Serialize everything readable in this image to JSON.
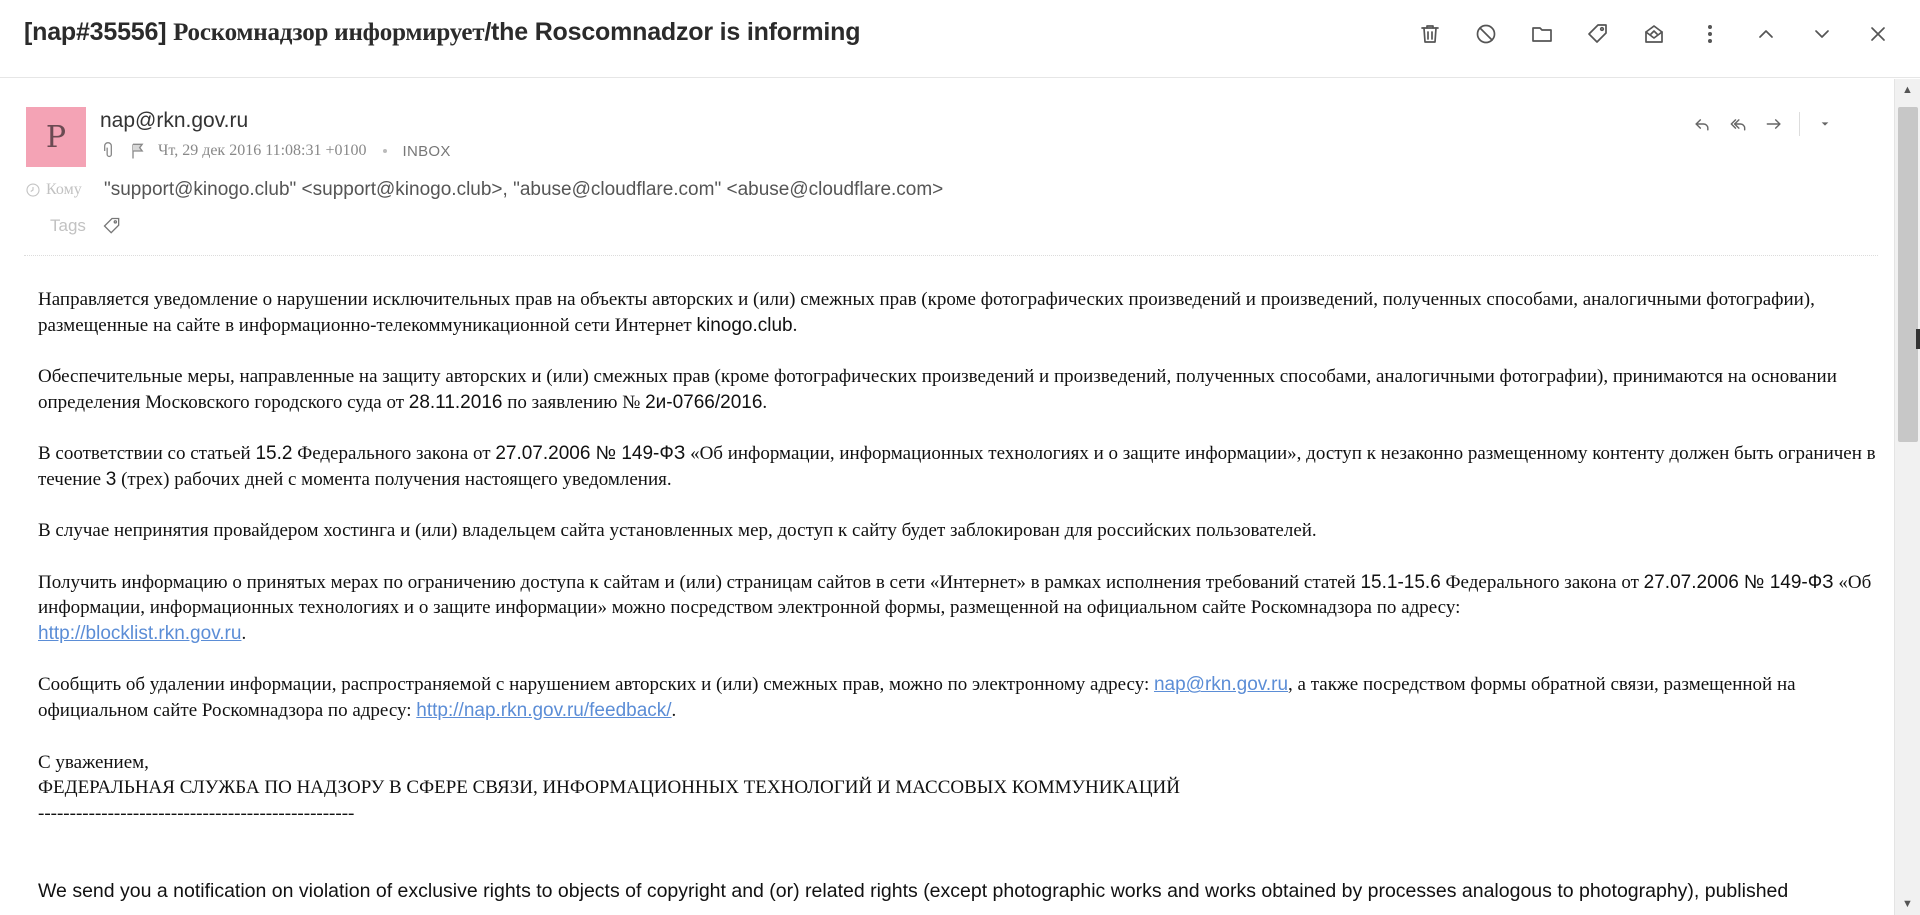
{
  "header": {
    "subject_prefix": "[nap#35556]",
    "subject_ru": "Роскомнадзор информирует",
    "subject_en": "/the Roscomnadzor is informing",
    "toolbar": [
      {
        "name": "delete-button",
        "icon": "trash-icon"
      },
      {
        "name": "spam-button",
        "icon": "block-icon"
      },
      {
        "name": "move-button",
        "icon": "folder-icon"
      },
      {
        "name": "tag-button",
        "icon": "tag-icon"
      },
      {
        "name": "archive-button",
        "icon": "archive-icon"
      },
      {
        "name": "more-button",
        "icon": "more-vertical-icon"
      },
      {
        "name": "prev-button",
        "icon": "chevron-up-icon"
      },
      {
        "name": "next-button",
        "icon": "chevron-down-icon"
      },
      {
        "name": "close-button",
        "icon": "close-icon"
      }
    ]
  },
  "message": {
    "avatar_letter": "P",
    "avatar_color": "#f4a3b5",
    "from": "nap@rkn.gov.ru",
    "date": "Чт, 29 дек 2016 11:08:31 +0100",
    "folder": "INBOX",
    "to_label": "Кому",
    "to_1": "\"support@kinogo.club\" <support@kinogo.club>",
    "to_sep": ", ",
    "to_2": "\"abuse@cloudflare.com\" <abuse@cloudflare.com>",
    "tags_label": "Tags"
  },
  "body": {
    "p1a": "Направляется уведомление о нарушении исключительных прав на объекты авторских и (или) смежных прав (кроме фотографических произведений и произведений, полученных способами, аналогичными фотографии), размещенные на сайте в информационно-телекоммуникационной сети Интернет ",
    "p1b": "kinogo.club",
    "p1c": ".",
    "p2a": "Обеспечительные меры, направленные на защиту авторских и (или) смежных прав (кроме фотографических произведений и произведений, полученных способами, аналогичными фотографии), принимаются на основании определения Московского городского суда от ",
    "p2b": "28.11.2016",
    "p2c": " по заявлению № ",
    "p2d": "2и-0766/2016",
    "p2e": ".",
    "p3a": "В соответствии со статьей ",
    "p3b": "15.2",
    "p3c": " Федерального закона от ",
    "p3d": "27.07.2006 № 149-ФЗ",
    "p3e": " «Об информации, информационных технологиях и о защите информации», доступ к незаконно размещенному контенту должен быть ограничен в течение ",
    "p3f": "3",
    "p3g": " (трех) рабочих дней с момента получения настоящего уведомления.",
    "p4": "В случае непринятия провайдером хостинга и (или) владельцем сайта установленных мер, доступ к сайту будет заблокирован для российских пользователей.",
    "p5a": "Получить информацию о принятых мерах по ограничению доступа к сайтам и (или) страницам сайтов в сети «Интернет» в рамках исполнения требований статей ",
    "p5b": "15.1-15.6",
    "p5c": " Федерального закона от ",
    "p5d": "27.07.2006 № 149-ФЗ",
    "p5e": " «Об информации, информационных технологиях и о защите информации» можно посредством электронной формы, размещенной на официальном сайте Роскомнадзора по адресу: ",
    "p5_link": "http://blocklist.rkn.gov.ru",
    "p5f": ".",
    "p6a": "Сообщить об удалении информации, распространяемой с нарушением авторских и (или) смежных прав, можно по электронному адресу: ",
    "p6_link1": "nap@rkn.gov.ru",
    "p6b": ", а также посредством формы обратной связи, размещенной на официальном сайте Роскомнадзора по адресу: ",
    "p6_link2": "http://nap.rkn.gov.ru/feedback/",
    "p6c": ".",
    "sign1": "С уважением,",
    "sign2": "ФЕДЕРАЛЬНАЯ СЛУЖБА ПО НАДЗОРУ В СФЕРЕ СВЯЗИ, ИНФОРМАЦИОННЫХ ТЕХНОЛОГИЙ И МАССОВЫХ КОММУНИКАЦИЙ",
    "sign3": "--------------------------------------------------",
    "en1": "We send you a notification on violation of exclusive rights to objects of copyright and (or) related rights (except photographic works and works obtained by processes analogous to photography), published"
  }
}
